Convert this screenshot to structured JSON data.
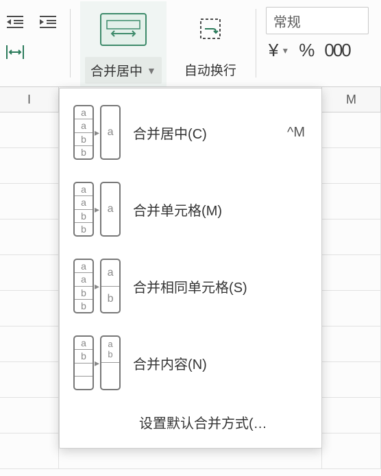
{
  "toolbar": {
    "merge_label": "合并居中",
    "wrap_label": "自动换行",
    "format_value": "常规",
    "currency_symbol": "¥",
    "percent_symbol": "%",
    "thousands_symbol": "000",
    "icons": {
      "indent_decrease": "indent-decrease-icon",
      "indent_increase": "indent-increase-icon",
      "distribute_horizontal": "distribute-horizontal-icon",
      "merge_arrow": "↔"
    }
  },
  "columns": [
    "I",
    "",
    "M"
  ],
  "menu": {
    "items": [
      {
        "label": "合并居中(C)",
        "shortcut": "^M"
      },
      {
        "label": "合并单元格(M)",
        "shortcut": ""
      },
      {
        "label": "合并相同单元格(S)",
        "shortcut": ""
      },
      {
        "label": "合并内容(N)",
        "shortcut": ""
      }
    ],
    "last_label": "设置默认合并方式(…"
  },
  "glyphs": {
    "a": "a",
    "b": "b"
  }
}
